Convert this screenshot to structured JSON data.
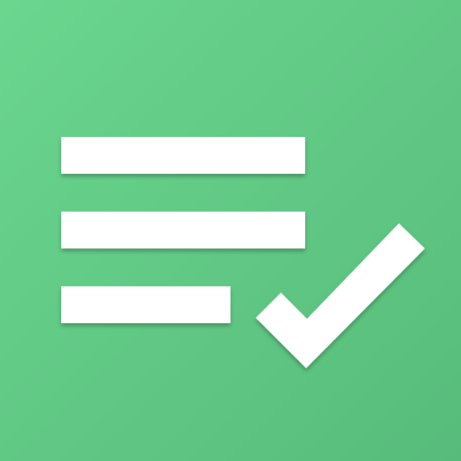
{
  "icon": {
    "semantic": "checklist-icon",
    "background_color_top": "#6ad68e",
    "background_color_bottom": "#57bc7b",
    "foreground_color": "#ffffff",
    "elements": {
      "lines": [
        "list-line-1-icon",
        "list-line-2-icon",
        "list-line-3-icon"
      ],
      "check": "checkmark-icon"
    }
  }
}
